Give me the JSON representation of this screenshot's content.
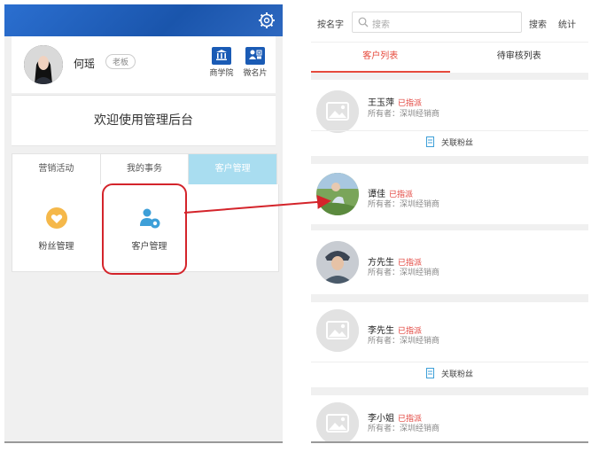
{
  "left": {
    "profile": {
      "name": "何瑶",
      "role_badge": "老板",
      "buttons": [
        {
          "label": "商学院",
          "icon": "bank-icon"
        },
        {
          "label": "微名片",
          "icon": "contact-card-icon"
        }
      ]
    },
    "welcome": "欢迎使用管理后台",
    "tabs": [
      {
        "label": "营销活动",
        "active": false
      },
      {
        "label": "我的事务",
        "active": false
      },
      {
        "label": "客户管理",
        "active": true
      }
    ],
    "grid": [
      {
        "label": "粉丝管理",
        "icon": "heart-icon"
      },
      {
        "label": "客户管理",
        "icon": "customer-settings-icon"
      }
    ]
  },
  "right": {
    "search": {
      "by_label": "按名字",
      "placeholder": "搜索",
      "search_button": "搜索",
      "stats_button": "统计"
    },
    "tabs": [
      {
        "label": "客户列表",
        "active": true
      },
      {
        "label": "待审核列表",
        "active": false
      }
    ],
    "customers": [
      {
        "name": "王玉萍",
        "status": "已指派",
        "owner": "所有者：深圳经销商",
        "link": "关联粉丝"
      },
      {
        "name": "谭佳",
        "status": "已指派",
        "owner": "所有者：深圳经销商"
      },
      {
        "name": "方先生",
        "status": "已指派",
        "owner": "所有者：深圳经销商"
      },
      {
        "name": "李先生",
        "status": "已指派",
        "owner": "所有者：深圳经销商",
        "link": "关联粉丝"
      },
      {
        "name": "李小姐",
        "status": "已指派",
        "owner": "所有者：深圳经销商"
      }
    ]
  },
  "colors": {
    "header_blue": "#1f5fb8",
    "active_tab": "#a9ddf0",
    "accent_red": "#e64a3c",
    "annotation_red": "#d4242b"
  }
}
